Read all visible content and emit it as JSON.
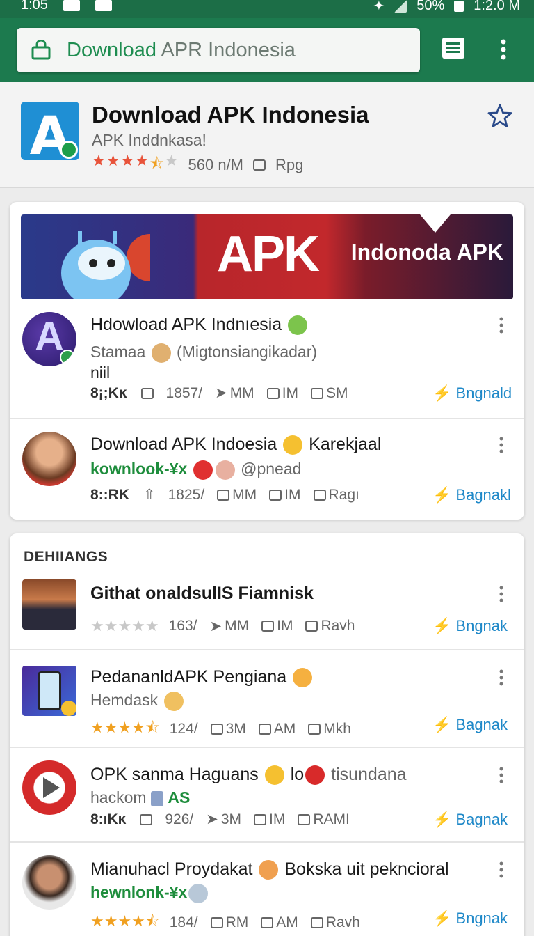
{
  "status_bar": {
    "left_text": "1:05",
    "battery": "50%",
    "time": "1:2.0 M"
  },
  "url_bar": {
    "url_highlight": "Download",
    "url_rest": " APR Indonesia"
  },
  "app_header": {
    "title": "Download APK Indonesia",
    "subtitle": "APK Inddnkasa!",
    "rating": 4.5,
    "downloads": "560 n/M",
    "size": "Rpg"
  },
  "banner": {
    "apk_text": "APK",
    "side_text": "Indonoda APK"
  },
  "featured": [
    {
      "title": "Hdowload APK Indnıesia",
      "subtitle": "Stamaa",
      "subtitle_extra": "(Migtonsiangikadar)",
      "line3": "niil",
      "stat_bold": "8¡;Kĸ",
      "stat_a": "1857/",
      "stat_b": "MM",
      "stat_c": "IM",
      "stat_d": "SM",
      "action": "Bngnald"
    },
    {
      "title": "Download APK Indoesia",
      "title_extra": "Karekjaal",
      "subtitle": "kownlook-¥x",
      "subtitle_extra": "@pnead",
      "stat_bold": "8::RK",
      "stat_a": "1825/",
      "stat_b": "MM",
      "stat_c": "IM",
      "stat_d": "Ragı",
      "action": "Bagnakl"
    }
  ],
  "section": {
    "heading": "DEHIIANGS",
    "items": [
      {
        "title": "Githat onaldsulIS Fiamnisk",
        "rating": 0,
        "stat_a": "163/",
        "stat_b": "MM",
        "stat_c": "IM",
        "stat_d": "Ravh",
        "action": "Bngnak"
      },
      {
        "title": "PedananldAPK Pengiana",
        "subtitle": "Hemdask",
        "rating": 4.5,
        "stat_a": "124/",
        "stat_b": "3M",
        "stat_c": "AM",
        "stat_d": "Mkh",
        "action": "Bagnak"
      },
      {
        "title": "OPK sanma Haguans",
        "title_mid": "lo",
        "title_extra": "tisundana",
        "subtitle": "hackom",
        "subtitle_extra": "AS",
        "stat_bold": "8:ıKĸ",
        "stat_a": "926/",
        "stat_b": "3M",
        "stat_c": "IM",
        "stat_d": "RAMI",
        "action": "Bagnak"
      },
      {
        "title": "Mianuhacl Proydakat",
        "title_extra": "Bokska uit pekncioral",
        "subtitle": "hewnlonk-¥x",
        "rating": 4.5,
        "stat_a": "184/",
        "stat_b": "RM",
        "stat_c": "AM",
        "stat_d": "Ravh",
        "action": "Bngnak"
      }
    ]
  },
  "colors": {
    "brand_green": "#1c7a4e",
    "link_blue": "#1e88c8",
    "star_red": "#e8533a",
    "star_gold": "#f0a020"
  },
  "icons": [
    "lock-icon",
    "reader-icon",
    "more-vert-icon",
    "star-outline-icon",
    "download-icon",
    "share-icon",
    "bookmark-icon",
    "bolt-icon"
  ]
}
